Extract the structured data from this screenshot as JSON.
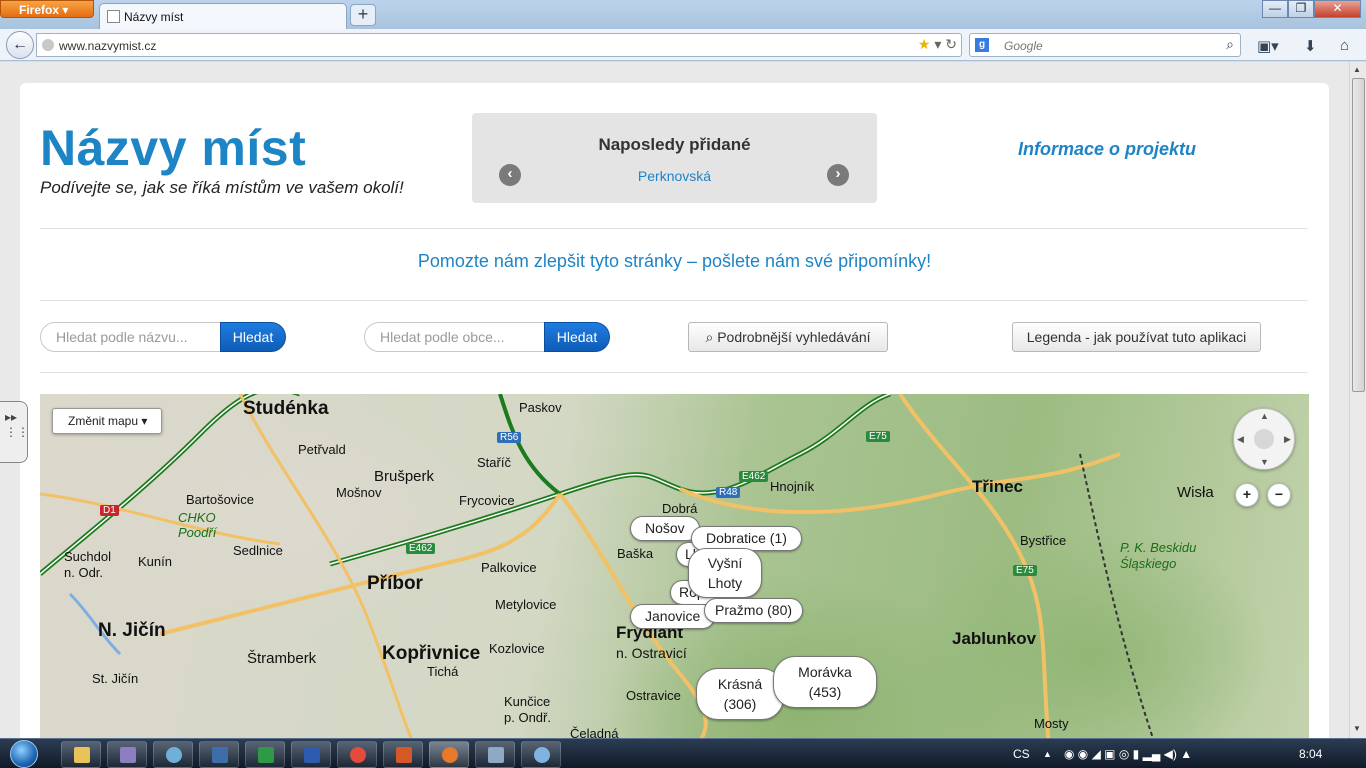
{
  "browser": {
    "menu_label": "Firefox",
    "tab_title": "Názvy míst",
    "new_tab": "+",
    "url": "www.nazvymist.cz",
    "search_placeholder": "Google"
  },
  "header": {
    "title": "Názvy míst",
    "tagline": "Podívejte se, jak se říká místům ve vašem okolí!",
    "recent_title": "Naposledy přidané",
    "recent_item": "Perknovská",
    "info_link": "Informace o projektu"
  },
  "feedback": "Pomozte nám zlepšit tyto stránky – pošlete nám své připomínky!",
  "search": {
    "name_placeholder": "Hledat podle názvu...",
    "name_button": "Hledat",
    "municipality_placeholder": "Hledat podle obce...",
    "municipality_button": "Hledat",
    "advanced": "Podrobnější vyhledávání",
    "legend": "Legenda - jak používat tuto aplikaci"
  },
  "map": {
    "change_map": "Změnit mapu",
    "places_big": [
      {
        "name": "Studénka"
      },
      {
        "name": "N. Jičín"
      },
      {
        "name": "Příbor"
      },
      {
        "name": "Kopřivnice"
      },
      {
        "name": "Třinec"
      },
      {
        "name": "Jablunkov"
      },
      {
        "name": "Frýdlant"
      }
    ],
    "places_small": [
      "Paskov",
      "Petřvald",
      "Brušperk",
      "Staříč",
      "Mošnov",
      "Frycovice",
      "Bartošovice",
      "CHKO Poodří",
      "Sedlnice",
      "Kunín",
      "Suchdol n. Odr.",
      "Palkovice",
      "Metylovice",
      "Baška",
      "Dobrá",
      "Hnojník",
      "Štramberk",
      "St. Jičín",
      "Kozlovice",
      "Tichá",
      "n. Ostravicí",
      "Ostravice",
      "Kunčice p. Ondř.",
      "Bystřice",
      "Wisła",
      "P. K. Beskidu Śląskiego",
      "Mosty",
      "Čeladná",
      "Nošov",
      "Lhota",
      "Ropice"
    ],
    "markers": [
      "Dobratice (1)",
      "Vyšní Lhoty",
      "Pražmo (80)",
      "Janovice",
      "Krásná (306)",
      "Morávka (453)"
    ]
  },
  "taskbar": {
    "lang": "CS",
    "clock": "8:04"
  }
}
